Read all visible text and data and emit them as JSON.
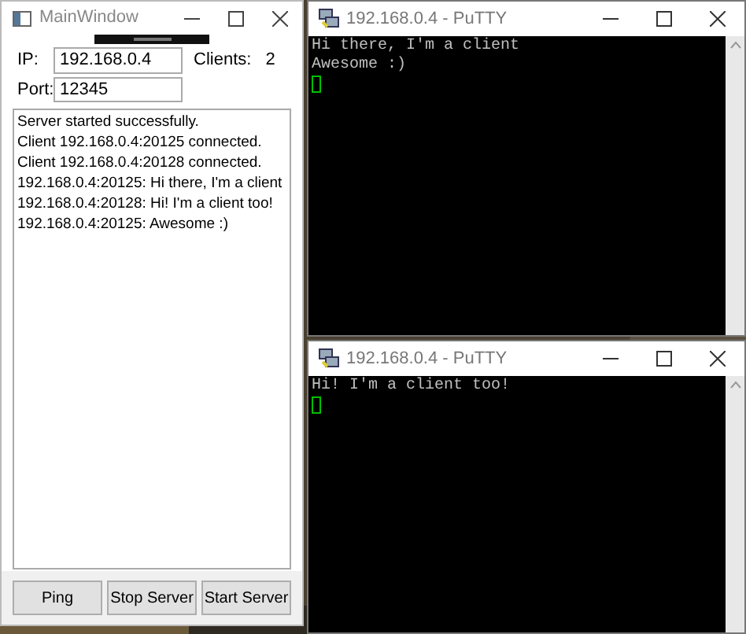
{
  "server_window": {
    "title": "MainWindow",
    "ip_label": "IP:",
    "ip_value": "192.168.0.4",
    "clients_label": "Clients:",
    "clients_count": "2",
    "port_label": "Port:",
    "port_value": "12345",
    "log": [
      "Server started successfully.",
      "Client 192.168.0.4:20125 connected.",
      "Client 192.168.0.4:20128 connected.",
      "192.168.0.4:20125: Hi there, I'm a client",
      "192.168.0.4:20128: Hi! I'm a client too!",
      "192.168.0.4:20125: Awesome :)"
    ],
    "buttons": [
      "Ping",
      "Stop Server",
      "Start Server"
    ]
  },
  "terminals": [
    {
      "title": "192.168.0.4 - PuTTY",
      "lines": [
        "Hi there, I'm a client",
        "Awesome :)"
      ]
    },
    {
      "title": "192.168.0.4 - PuTTY",
      "lines": [
        "Hi! I'm a client too!"
      ]
    }
  ]
}
